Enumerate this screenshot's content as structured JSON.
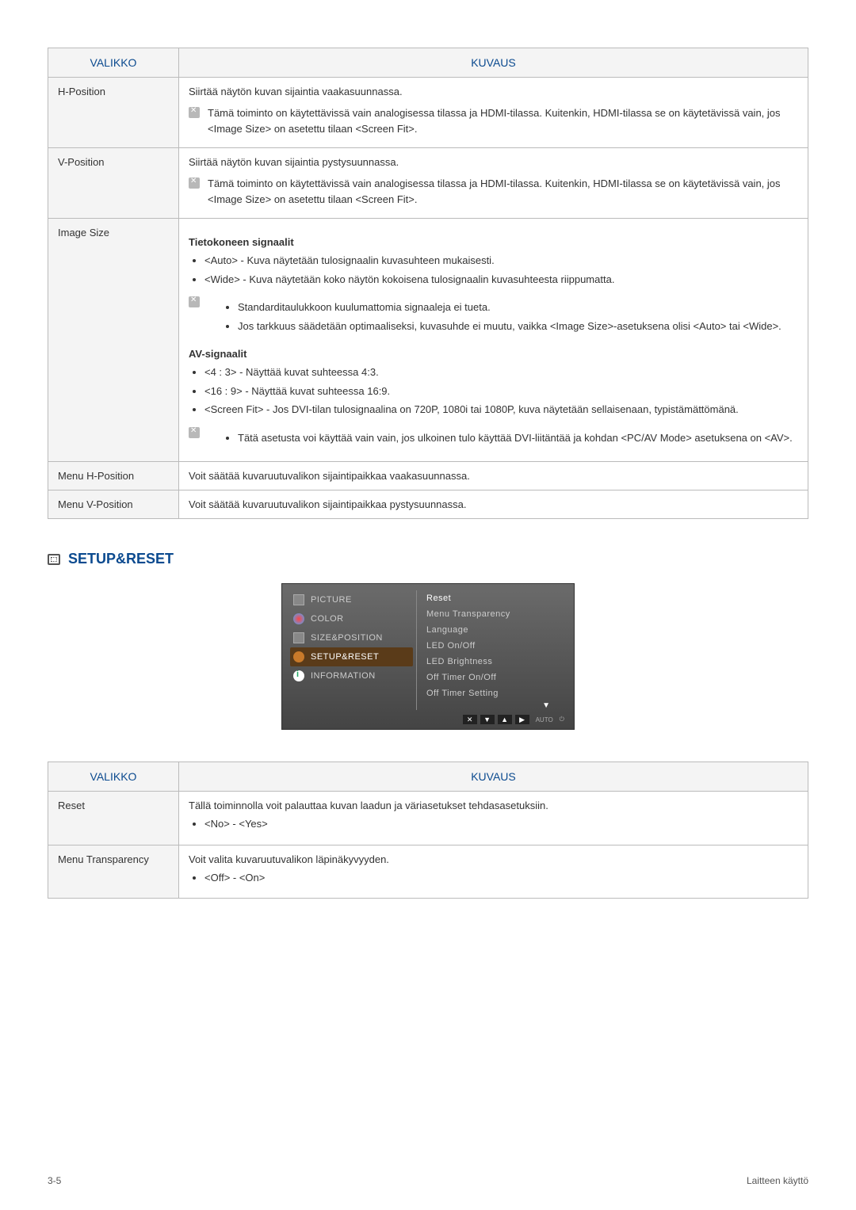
{
  "table1": {
    "headers": {
      "col1": "VALIKKO",
      "col2": "KUVAUS"
    },
    "rows": [
      {
        "menu": "H-Position",
        "intro": "Siirtää näytön kuvan sijaintia vaakasuunnassa.",
        "note": "Tämä toiminto on käytettävissä vain analogisessa tilassa ja HDMI-tilassa. Kuitenkin, HDMI-tilassa se on käytetävissä vain, jos <Image Size> on asetettu tilaan <Screen Fit>."
      },
      {
        "menu": "V-Position",
        "intro": "Siirtää näytön kuvan sijaintia pystysuunnassa.",
        "note": "Tämä toiminto on käytettävissä vain analogisessa tilassa ja HDMI-tilassa. Kuitenkin, HDMI-tilassa se on käytetävissä vain, jos <Image Size> on asetettu tilaan <Screen Fit>."
      },
      {
        "menu": "Image Size",
        "sub1": "Tietokoneen signaalit",
        "sub1_bullets": [
          "<Auto> - Kuva näytetään tulosignaalin kuvasuhteen mukaisesti.",
          "<Wide> - Kuva näytetään koko näytön kokoisena tulosignaalin kuvasuhteesta riippumatta."
        ],
        "sub1_note_bullets": [
          "Standarditaulukkoon kuulumattomia signaaleja ei tueta.",
          "Jos tarkkuus säädetään optimaaliseksi, kuvasuhde ei muutu, vaikka <Image Size>-asetuksena olisi <Auto> tai <Wide>."
        ],
        "sub2": "AV-signaalit",
        "sub2_bullets": [
          "<4 : 3> - Näyttää kuvat suhteessa 4:3.",
          "<16 : 9> - Näyttää kuvat suhteessa 16:9.",
          "<Screen Fit> - Jos DVI-tilan tulosignaalina on 720P, 1080i tai 1080P, kuva näytetään sellaisenaan, typistämättömänä."
        ],
        "sub2_note_bullets": [
          "Tätä asetusta voi käyttää vain vain, jos ulkoinen tulo käyttää DVI-liitäntää ja kohdan <PC/AV Mode> asetuksena on <AV>."
        ]
      },
      {
        "menu": "Menu H-Position",
        "intro": "Voit säätää kuvaruutuvalikon sijaintipaikkaa vaakasuunnassa."
      },
      {
        "menu": "Menu V-Position",
        "intro": "Voit säätää kuvaruutuvalikon sijaintipaikkaa pystysuunnassa."
      }
    ]
  },
  "section": {
    "title": "SETUP&RESET"
  },
  "osd": {
    "left": [
      {
        "label": "PICTURE",
        "icon": "picture"
      },
      {
        "label": "COLOR",
        "icon": "color"
      },
      {
        "label": "SIZE&POSITION",
        "icon": "size"
      },
      {
        "label": "SETUP&RESET",
        "icon": "setup",
        "active": true
      },
      {
        "label": "INFORMATION",
        "icon": "info"
      }
    ],
    "right": [
      "Reset",
      "Menu Transparency",
      "Language",
      "LED On/Off",
      "LED Brightness",
      "Off Timer On/Off",
      "Off Timer Setting"
    ],
    "footer": {
      "auto": "AUTO"
    }
  },
  "table2": {
    "headers": {
      "col1": "VALIKKO",
      "col2": "KUVAUS"
    },
    "rows": [
      {
        "menu": "Reset",
        "intro": "Tällä toiminnolla voit palauttaa kuvan laadun ja väriasetukset tehdasasetuksiin.",
        "bullet": "<No> - <Yes>"
      },
      {
        "menu": "Menu Transparency",
        "intro": "Voit valita kuvaruutuvalikon läpinäkyvyyden.",
        "bullet": "<Off> - <On>"
      }
    ]
  },
  "footer": {
    "left": "3-5",
    "right": "Laitteen käyttö"
  }
}
